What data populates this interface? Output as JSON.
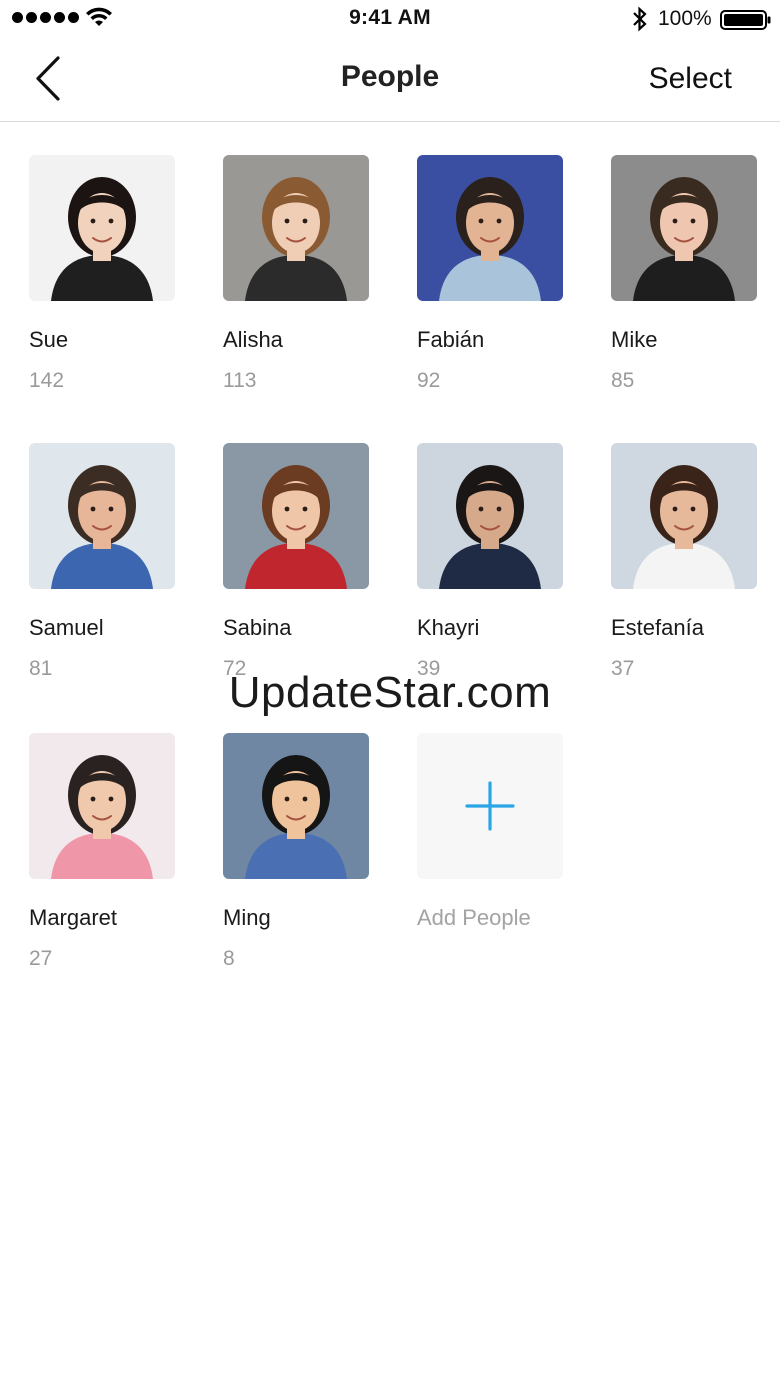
{
  "status_bar": {
    "time": "9:41 AM",
    "battery_percent": "100%",
    "signal_bars": 5,
    "battery_level": 1.0
  },
  "nav": {
    "title": "People",
    "select_label": "Select",
    "back_icon": "chevron-left-icon"
  },
  "people": [
    {
      "name": "Sue",
      "count": "142",
      "bg": "#f2f2f2",
      "skin": "#f1d3bd",
      "hair": "#1c1412",
      "shirt": "#1f1f1f"
    },
    {
      "name": "Alisha",
      "count": "113",
      "bg": "#9a9894",
      "skin": "#f0cdb5",
      "hair": "#8a5a32",
      "shirt": "#2b2b2b"
    },
    {
      "name": "Fabián",
      "count": "92",
      "bg": "#3a4fa1",
      "skin": "#e3b493",
      "hair": "#2a211c",
      "shirt": "#a9c3da"
    },
    {
      "name": "Mike",
      "count": "85",
      "bg": "#8c8c8c",
      "skin": "#efc7b0",
      "hair": "#3a2b20",
      "shirt": "#1e1e1e"
    },
    {
      "name": "Samuel",
      "count": "81",
      "bg": "#dfe6ec",
      "skin": "#e7b699",
      "hair": "#3b2d24",
      "shirt": "#3c66b0"
    },
    {
      "name": "Sabina",
      "count": "72",
      "bg": "#8a98a6",
      "skin": "#f0c6a8",
      "hair": "#6b3b22",
      "shirt": "#c0262e"
    },
    {
      "name": "Khayri",
      "count": "39",
      "bg": "#cdd6df",
      "skin": "#d7a98b",
      "hair": "#1a1615",
      "shirt": "#1f2a44"
    },
    {
      "name": "Estefanía",
      "count": "37",
      "bg": "#cfd8e1",
      "skin": "#e7b99b",
      "hair": "#3a2419",
      "shirt": "#f4f4f4"
    },
    {
      "name": "Margaret",
      "count": "27",
      "bg": "#f1e9ec",
      "skin": "#f0c9ad",
      "hair": "#2a2221",
      "shirt": "#ef97a8"
    },
    {
      "name": "Ming",
      "count": "8",
      "bg": "#6f87a3",
      "skin": "#efc39c",
      "hair": "#151515",
      "shirt": "#4a6fb3"
    }
  ],
  "add_people": {
    "label": "Add People",
    "icon": "plus-icon",
    "accent": "#2aa6e6"
  },
  "watermark": "UpdateStar.com"
}
